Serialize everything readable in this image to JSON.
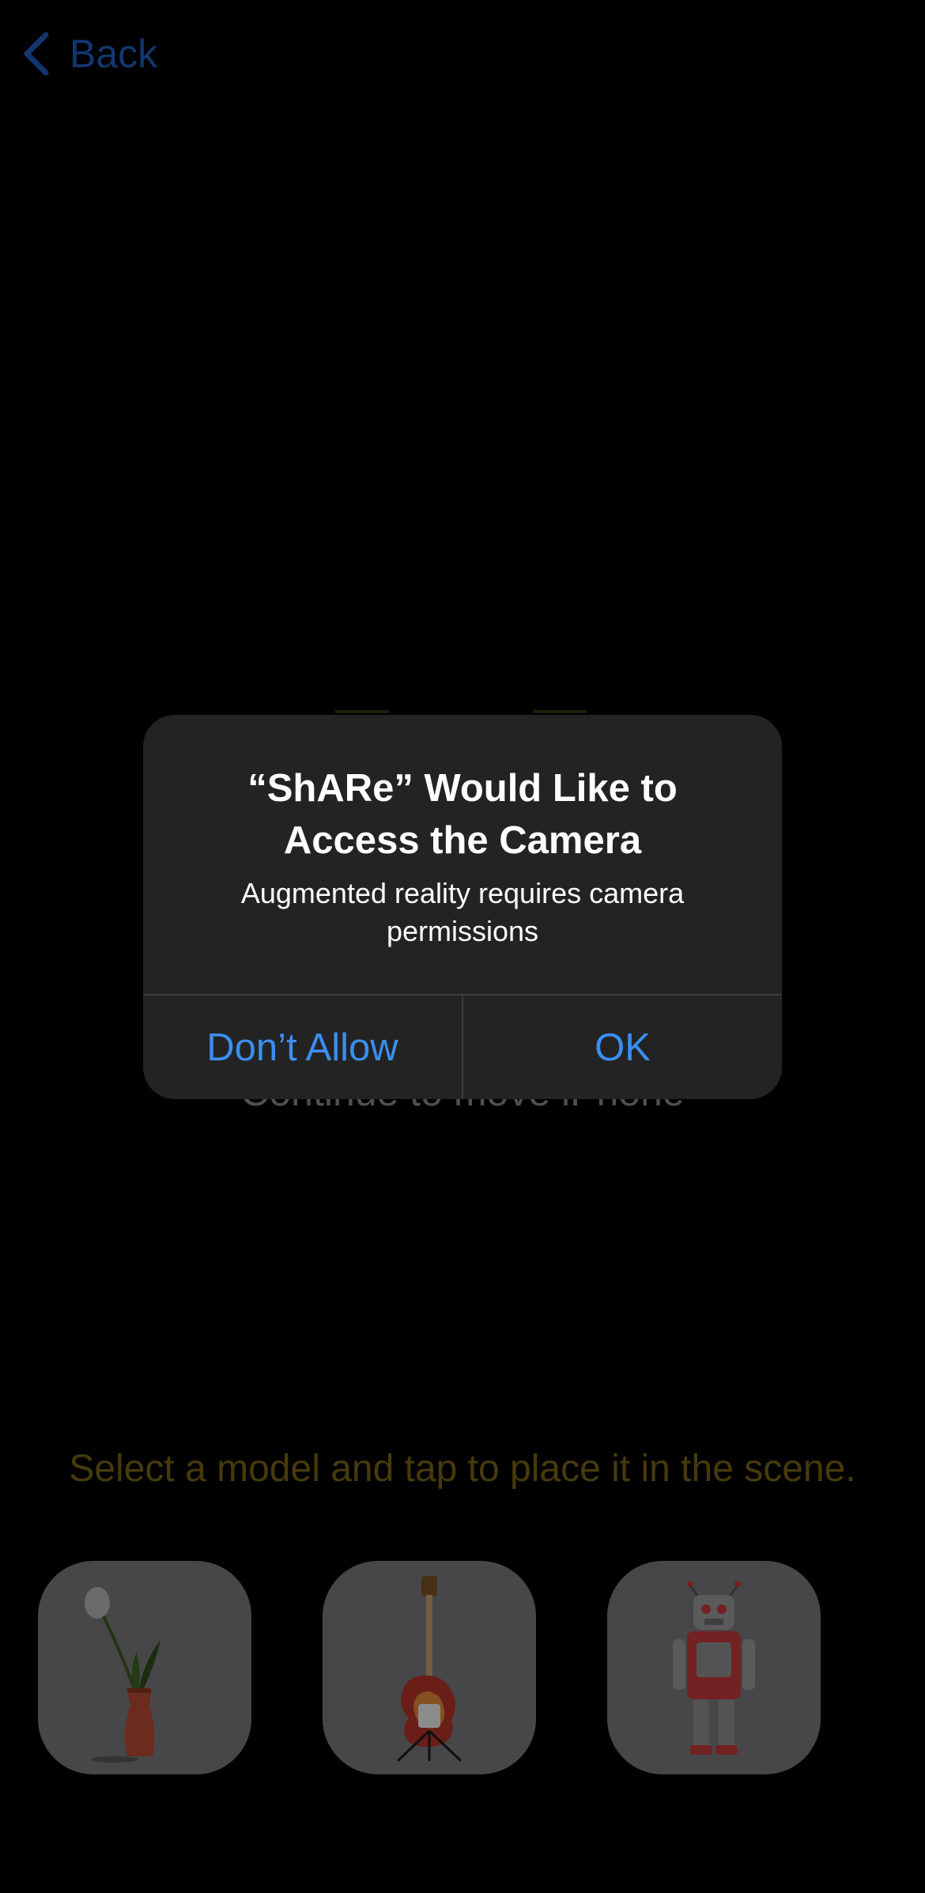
{
  "nav": {
    "back_label": "Back",
    "back_icon": "chevron-left-icon"
  },
  "ar": {
    "coaching_text": "Continue to move iPhone"
  },
  "instruction": "Select a model and tap to place it in the scene.",
  "models": [
    {
      "name": "vase-model",
      "icon": "vase-with-plant-icon"
    },
    {
      "name": "guitar-model",
      "icon": "electric-guitar-icon"
    },
    {
      "name": "robot-model",
      "icon": "toy-robot-icon"
    }
  ],
  "alert": {
    "title": "“ShARe” Would Like to Access the Camera",
    "message": "Augmented reality requires camera permissions",
    "deny_label": "Don’t Allow",
    "allow_label": "OK"
  },
  "colors": {
    "accent": "#3b8ef0",
    "instruction": "#7a6414",
    "card": "#7a7a7e",
    "alert_bg": "#232324"
  }
}
